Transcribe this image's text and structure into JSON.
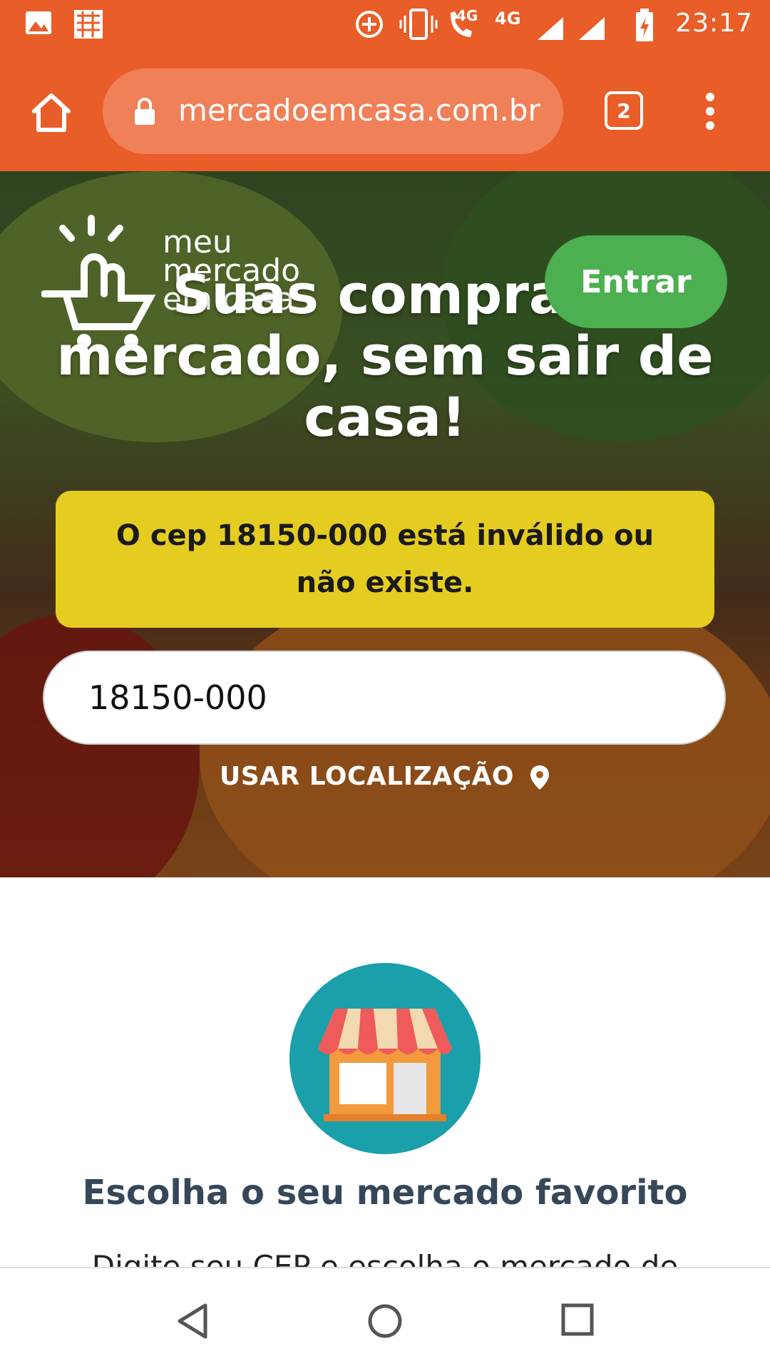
{
  "status_bar": {
    "time": "23:17",
    "net_4g_small": "4G",
    "net_4g": "4G",
    "icons": [
      "image-icon",
      "app-icon",
      "data-saver-icon",
      "vibrate-icon",
      "wifi-calling-icon",
      "signal-icon",
      "signal-icon",
      "battery-charging-icon"
    ]
  },
  "browser": {
    "url": "mercadoemcasa.com.br",
    "tab_count": "2"
  },
  "hero": {
    "logo_text_line1": "meu",
    "logo_text_line2": "mercado",
    "logo_text_line3": "em casa",
    "login_label": "Entrar",
    "headline": "Suas compras mercado, sem sair de casa!",
    "alert_text": "O cep 18150-000 está inválido ou não existe.",
    "cep_value": "18150-000",
    "use_location_label": "USAR LOCALIZAÇÃO"
  },
  "content": {
    "title": "Escolha o seu mercado favorito",
    "subtitle": "Digite seu CEP e escolha o mercado de"
  },
  "colors": {
    "brand_orange": "#e95d28",
    "login_green": "#4caf50",
    "alert_yellow": "#e5cc21",
    "store_teal": "#1a9fab",
    "title_slate": "#37475a"
  }
}
